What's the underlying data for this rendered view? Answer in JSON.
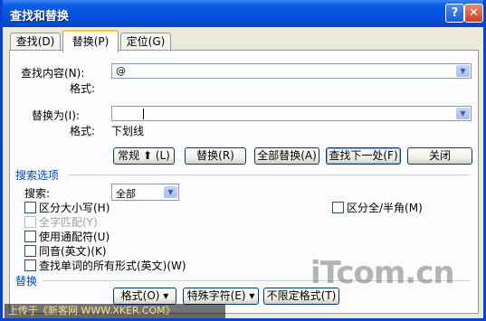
{
  "window": {
    "title": "查找和替换",
    "help_glyph": "?",
    "close_glyph": "✕"
  },
  "tabs": [
    {
      "label": "查找(D)"
    },
    {
      "label": "替换(P)"
    },
    {
      "label": "定位(G)"
    }
  ],
  "find": {
    "label": "查找内容(N):",
    "value": "@",
    "format_label": "格式:"
  },
  "replace": {
    "label": "替换为(I):",
    "value": "",
    "format_label": "格式:",
    "format_value": "下划线"
  },
  "buttons": {
    "more": "常规 ⬆ (L)",
    "replace": "替换(R)",
    "replace_all": "全部替换(A)",
    "find_next": "查找下一处(F)",
    "close": "关闭"
  },
  "search_options": {
    "section_label": "搜索选项",
    "search_label": "搜索:",
    "search_value": "全部",
    "options": [
      {
        "label": "区分大小写(H)",
        "checked": false,
        "enabled": true
      },
      {
        "label": "全字匹配(Y)",
        "checked": false,
        "enabled": false
      },
      {
        "label": "使用通配符(U)",
        "checked": false,
        "enabled": true
      },
      {
        "label": "同音(英文)(K)",
        "checked": false,
        "enabled": true
      },
      {
        "label": "查找单词的所有形式(英文)(W)",
        "checked": false,
        "enabled": true
      }
    ],
    "halfwidth": {
      "label": "区分全/半角(M)",
      "checked": false
    }
  },
  "replace_section": {
    "label": "替换",
    "format_button": "格式(O) ▾",
    "special_button": "特殊字符(E) ▾",
    "no_format_button": "不限定格式(T)"
  },
  "watermarks": {
    "logo_text": "iTcom.cn",
    "banner": "上传于《新客网 WWW.XKER.COM》"
  }
}
